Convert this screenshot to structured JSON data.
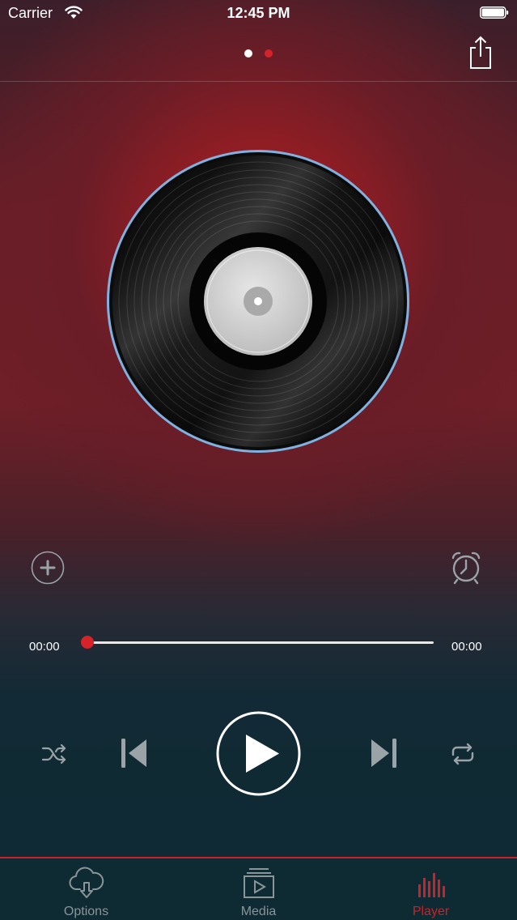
{
  "status_bar": {
    "carrier": "Carrier",
    "time": "12:45 PM"
  },
  "nav": {
    "page_count": 2,
    "current_page": 1,
    "share_icon": "share-icon"
  },
  "player": {
    "artwork": "vinyl-record",
    "elapsed": "00:00",
    "duration": "00:00",
    "progress": 0
  },
  "tabs": [
    {
      "label": "Options",
      "icon": "cloud-download-icon",
      "active": false
    },
    {
      "label": "Media",
      "icon": "media-library-icon",
      "active": false
    },
    {
      "label": "Player",
      "icon": "equalizer-icon",
      "active": true
    }
  ],
  "colors": {
    "accent": "#d6232a",
    "tab_active": "#c8232a",
    "tab_inactive": "#8a9499",
    "control_gray": "#9aa3a8"
  }
}
